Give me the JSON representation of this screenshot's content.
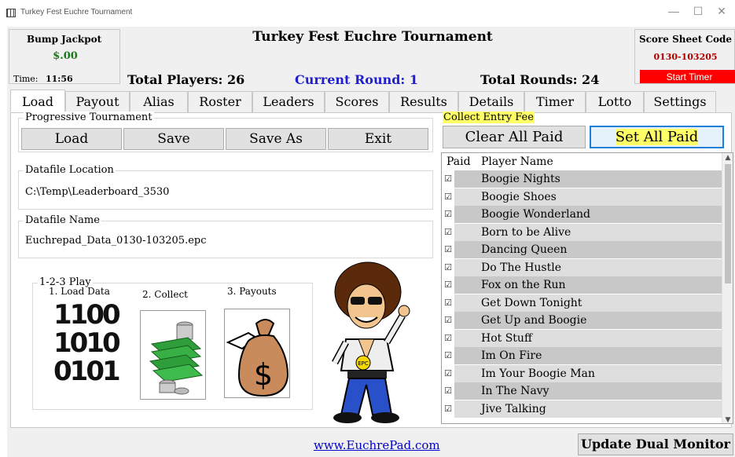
{
  "window": {
    "title": "Turkey Fest Euchre Tournament",
    "controls": {
      "minimize": "—",
      "maximize": "☐",
      "close": "✕"
    }
  },
  "header": {
    "bump_label": "Bump Jackpot",
    "bump_value": "$.00",
    "time_label": "Time:",
    "time_value": "11:56",
    "title": "Turkey Fest Euchre Tournament",
    "score_sheet_label": "Score Sheet Code",
    "score_sheet_value": "0130-103205",
    "start_timer": "Start Timer",
    "total_players": "Total Players:  26",
    "current_round": "Current Round:  1",
    "total_rounds": "Total Rounds:  24"
  },
  "tabs": [
    "Load",
    "Payout",
    "Alias",
    "Roster",
    "Leaders",
    "Scores",
    "Results",
    "Details",
    "Timer",
    "Lotto",
    "Settings"
  ],
  "load": {
    "group_label": "Progressive Tournament",
    "buttons": [
      "Load",
      "Save",
      "Save As",
      "Exit"
    ],
    "datafile_location_label": "Datafile Location",
    "datafile_location": "C:\\Temp\\Leaderboard_3530",
    "datafile_name_label": "Datafile Name",
    "datafile_name": "Euchrepad_Data_0130-103205.epc",
    "play_label": "1-2-3 Play",
    "steps": [
      "1. Load Data",
      "2. Collect",
      "3. Payouts"
    ],
    "binary_lines": [
      "1100",
      "1010",
      "0101"
    ],
    "mascot_badge": "EPC"
  },
  "fees": {
    "label": "Collect Entry Fee",
    "clear_button": "Clear All Paid",
    "set_button": "Set All Paid",
    "columns": [
      "Paid",
      "Player Name"
    ],
    "players": [
      "Boogie Nights",
      "Boogie Shoes",
      "Boogie Wonderland",
      "Born to be Alive",
      "Dancing Queen",
      "Do The Hustle",
      "Fox on the Run",
      "Get Down Tonight",
      "Get Up and Boogie",
      "Hot Stuff",
      "Im On Fire",
      "Im Your Boogie Man",
      "In The Navy",
      "Jive Talking"
    ],
    "check_glyph": "☑"
  },
  "footer": {
    "link": "www.EuchrePad.com",
    "dual_monitor": "Update Dual Monitor"
  },
  "colors": {
    "row_dark": "#c8c8c8",
    "row_light": "#dedede",
    "accent_red": "#ff0000",
    "money_green": "#1a7a1a",
    "round_blue": "#1f1fd0",
    "highlight": "#ffff66"
  }
}
